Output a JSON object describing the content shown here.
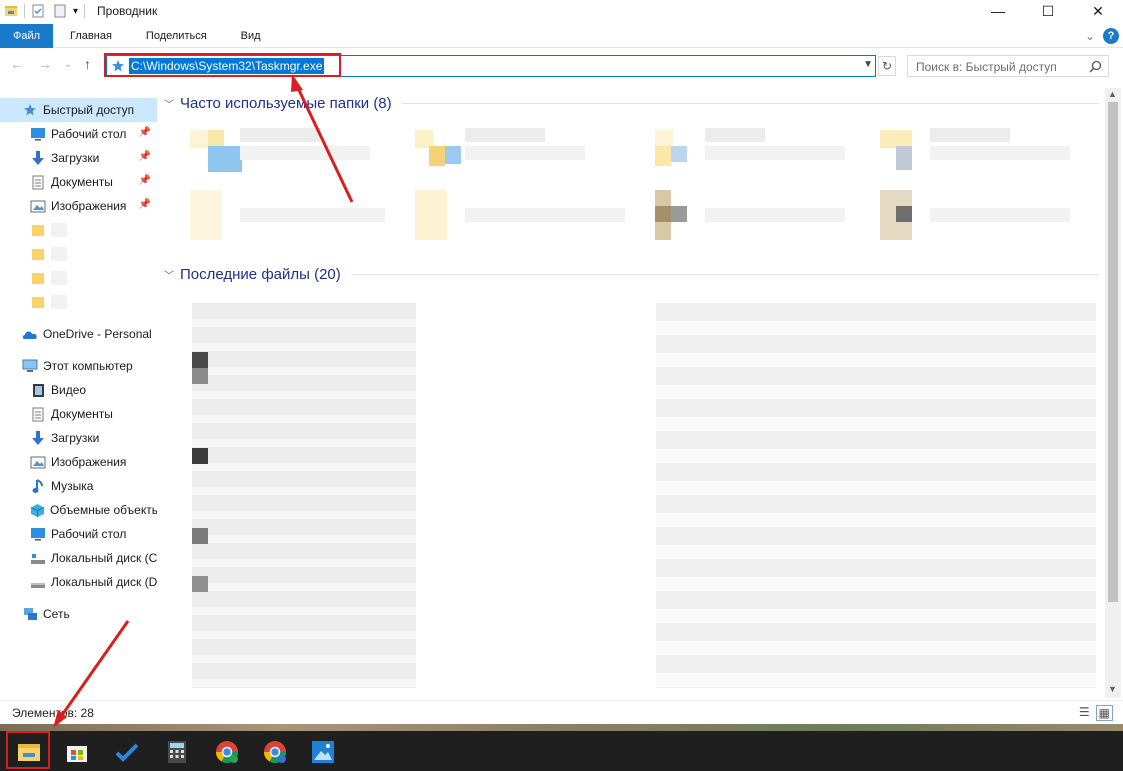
{
  "window": {
    "title": "Проводник",
    "minimize": "—",
    "maximize": "☐",
    "close": "✕"
  },
  "ribbon": {
    "tabs": [
      "Файл",
      "Главная",
      "Поделиться",
      "Вид"
    ],
    "expand": "⌄",
    "help": "?"
  },
  "navigation": {
    "back": "←",
    "forward": "→",
    "recent": "⌄",
    "up": "↑",
    "address": "C:\\Windows\\System32\\Taskmgr.exe",
    "refresh": "↻",
    "search_placeholder": "Поиск в: Быстрый доступ"
  },
  "sidebar": {
    "quick_access": "Быстрый доступ",
    "pinned": [
      {
        "label": "Рабочий стол",
        "icon": "desktop-icon"
      },
      {
        "label": "Загрузки",
        "icon": "download-icon"
      },
      {
        "label": "Документы",
        "icon": "documents-icon"
      },
      {
        "label": "Изображения",
        "icon": "pictures-icon"
      }
    ],
    "onedrive": "OneDrive - Personal",
    "this_pc": "Этот компьютер",
    "pc_items": [
      {
        "label": "Видео",
        "icon": "video-icon"
      },
      {
        "label": "Документы",
        "icon": "documents-icon"
      },
      {
        "label": "Загрузки",
        "icon": "download-icon"
      },
      {
        "label": "Изображения",
        "icon": "pictures-icon"
      },
      {
        "label": "Музыка",
        "icon": "music-icon"
      },
      {
        "label": "Объемные объекты",
        "icon": "3d-objects-icon"
      },
      {
        "label": "Рабочий стол",
        "icon": "desktop-icon"
      },
      {
        "label": "Локальный диск (C:)",
        "icon": "drive-c-icon"
      },
      {
        "label": "Локальный диск (D:)",
        "icon": "drive-d-icon"
      }
    ],
    "network": "Сеть"
  },
  "content": {
    "frequent_header": "Часто используемые папки (8)",
    "recent_header": "Последние файлы (20)"
  },
  "status": {
    "items": "Элементов: 28"
  },
  "taskbar": {
    "apps": [
      "file-explorer-icon",
      "store-icon",
      "todo-icon",
      "calculator-icon",
      "chrome-c-icon",
      "chrome-s-icon",
      "photos-icon"
    ]
  },
  "colors": {
    "accent": "#0078d7",
    "file_tab": "#1979ca",
    "selection": "#cce8ff",
    "annotation": "#d81e1e",
    "group_header": "#1e3287"
  }
}
